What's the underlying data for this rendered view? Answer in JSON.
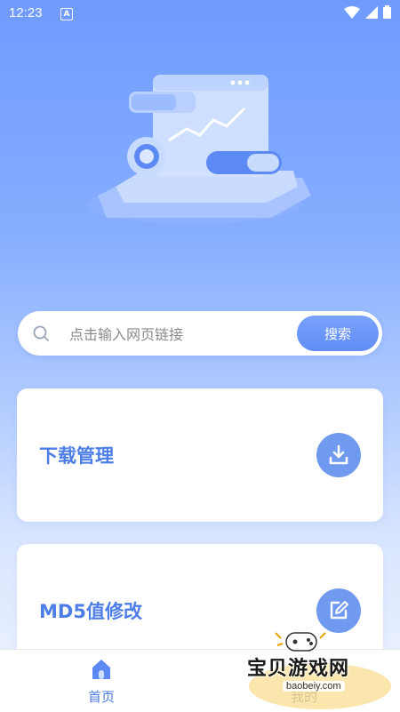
{
  "status": {
    "time": "12:23",
    "badge": "A"
  },
  "search": {
    "placeholder": "点击输入网页链接",
    "button_label": "搜索"
  },
  "cards": [
    {
      "title": "下载管理",
      "icon": "download-icon"
    },
    {
      "title": "MD5值修改",
      "icon": "edit-icon"
    }
  ],
  "tabbar": {
    "items": [
      {
        "label": "首页",
        "icon": "home-icon",
        "active": true
      },
      {
        "label": "我的",
        "icon": "user-icon",
        "active": false
      }
    ]
  },
  "watermark": {
    "text": "宝贝游戏网",
    "url": "baobeiy.com"
  },
  "colors": {
    "accent": "#4d7de6",
    "button": "#6f9aef",
    "bg_top": "#6f9bff"
  }
}
